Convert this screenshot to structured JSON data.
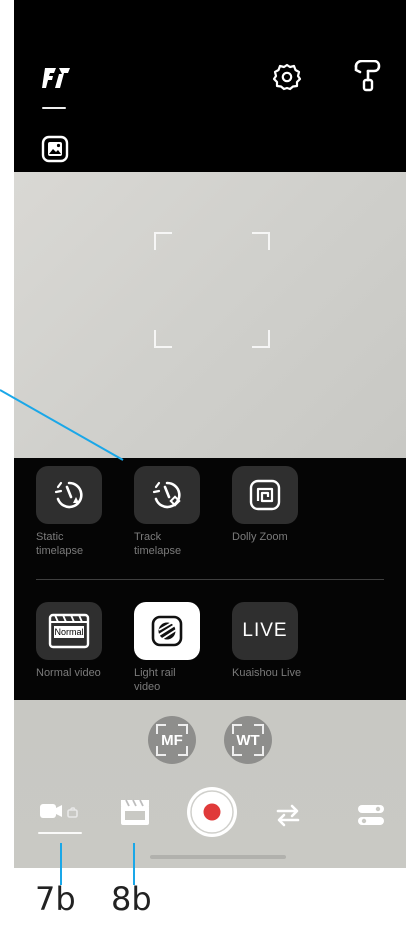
{
  "colors": {
    "accent_line": "#1aa7e8",
    "record_red": "#e03a3a",
    "panel_bg": "#050505",
    "tile_bg": "#2f2f2f"
  },
  "topbar": {
    "brand_icon": "feiyu-logo-icon",
    "gallery_icon": "gallery-icon",
    "settings_icon": "settings-gear-icon",
    "gimbal_icon": "gimbal-icon"
  },
  "modes": {
    "timelapse": [
      {
        "label": "Static\ntimelapse",
        "icon": "static-timelapse-icon"
      },
      {
        "label": "Track\ntimelapse",
        "icon": "track-timelapse-icon"
      },
      {
        "label": "Dolly Zoom",
        "icon": "dolly-zoom-icon"
      }
    ],
    "video": [
      {
        "label": "Normal video",
        "icon": "normal-video-icon"
      },
      {
        "label": "Light rail\nvideo",
        "icon": "light-rail-video-icon",
        "selected": true
      },
      {
        "label": "Kuaishou Live",
        "icon": "kuaishou-live-icon",
        "badge": "LIVE"
      }
    ],
    "normal_badge": "Normal"
  },
  "controls": {
    "mf_label": "MF",
    "wt_label": "WT"
  },
  "toolbar": {
    "video_icon": "video-camera-icon",
    "clapper_icon": "clapperboard-icon",
    "record_icon": "record-icon",
    "flip_icon": "flip-camera-icon",
    "toggle_icon": "toggle-settings-icon"
  },
  "annotations": {
    "a7b": "7b",
    "a8b": "8b"
  }
}
